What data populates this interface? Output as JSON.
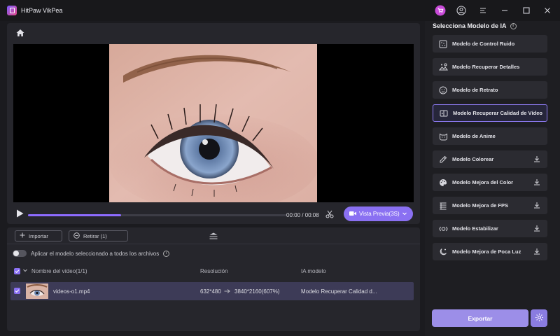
{
  "app": {
    "title": "HitPaw VikPea"
  },
  "player": {
    "time": "00:00 / 00:08",
    "preview_label": "Vista Previa(3S)",
    "progress": 0.36
  },
  "toolbar": {
    "import_label": "Importar",
    "remove_label": "Retirar (1)"
  },
  "apply_all": {
    "label": "Aplicar el modelo seleccionado a todos los archivos",
    "enabled": false
  },
  "table": {
    "headers": {
      "name": "Nombre del vídeo(1/1)",
      "resolution": "Resolución",
      "model": "IA modelo"
    },
    "rows": [
      {
        "name": "videos-o1.mp4",
        "res_from": "632*480",
        "res_to": "3840*2160(607%)",
        "model": "Modelo Recuperar Calidad d..."
      }
    ]
  },
  "models": {
    "title": "Selecciona Modelo de IA",
    "items": [
      {
        "label": "Modelo de Control Ruido",
        "icon": "noise-icon",
        "download": false,
        "selected": false
      },
      {
        "label": "Modelo Recuperar Detalles",
        "icon": "details-icon",
        "download": false,
        "selected": false
      },
      {
        "label": "Modelo de Retrato",
        "icon": "portrait-icon",
        "download": false,
        "selected": false
      },
      {
        "label": "Modelo Recuperar Calidad de Vídeo",
        "icon": "video-quality-icon",
        "download": false,
        "selected": true
      },
      {
        "label": "Modelo de Anime",
        "icon": "anime-icon",
        "download": false,
        "selected": false
      },
      {
        "label": "Modelo Colorear",
        "icon": "colorize-icon",
        "download": true,
        "selected": false
      },
      {
        "label": "Modelo Mejora del Color",
        "icon": "palette-icon",
        "download": true,
        "selected": false
      },
      {
        "label": "Modelo Mejora de FPS",
        "icon": "fps-icon",
        "download": true,
        "selected": false
      },
      {
        "label": "Modelo Estabilizar",
        "icon": "stabilize-icon",
        "download": true,
        "selected": false
      },
      {
        "label": "Modelo Mejora de Poca Luz",
        "icon": "lowlight-icon",
        "download": true,
        "selected": false
      }
    ]
  },
  "export": {
    "label": "Exportar"
  },
  "colors": {
    "accent": "#8a70f2",
    "panel": "#26262c",
    "background": "#1b1b1f"
  }
}
